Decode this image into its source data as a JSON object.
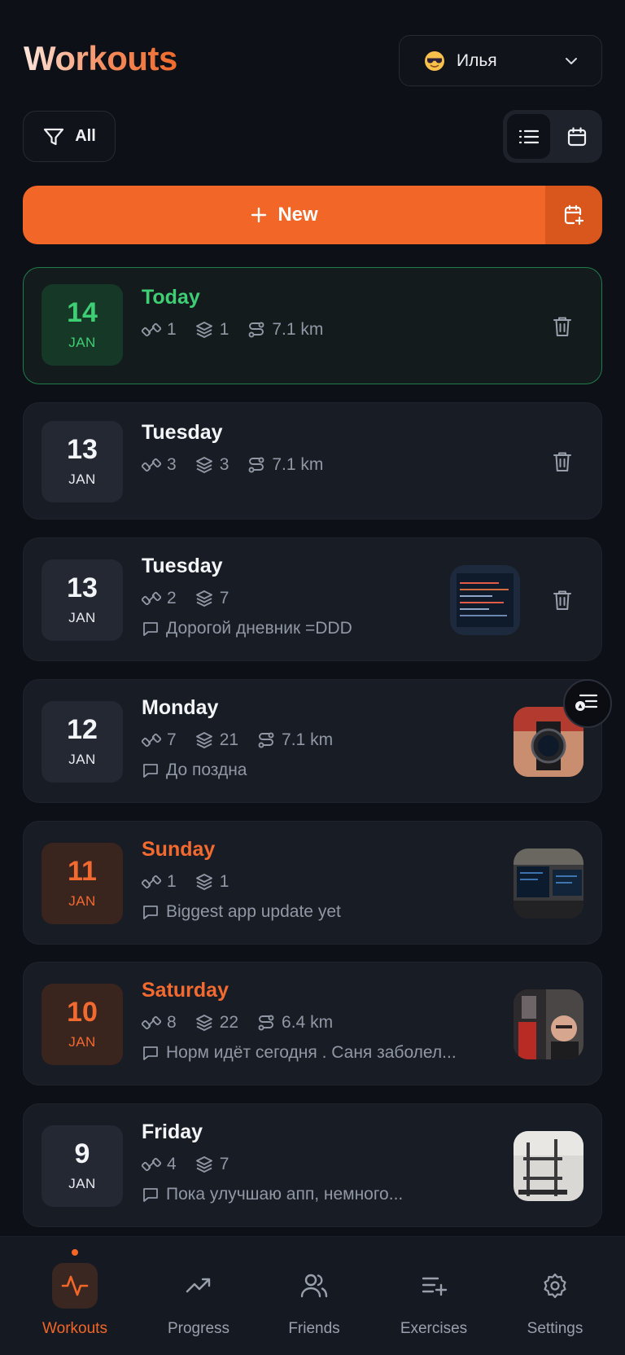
{
  "header": {
    "title": "Workouts",
    "user": {
      "name": "Илья",
      "avatar_icon": "smiling-face-with-sunglasses-emoji"
    }
  },
  "filter": {
    "label": "All"
  },
  "view_toggle": {
    "options": [
      "list",
      "calendar"
    ],
    "selected": "list"
  },
  "new_button": {
    "label": "New",
    "side_icon": "calendar-plus-icon"
  },
  "colors": {
    "accent": "#f26627",
    "today": "#3fce74",
    "weekend": "#f26a30",
    "background": "#0d1017",
    "card": "#181c25"
  },
  "workouts": [
    {
      "day": "14",
      "month": "JAN",
      "weekday": "Today",
      "exercises": "1",
      "sets": "1",
      "distance": "7.1 km",
      "note": "",
      "has_photo": false,
      "has_delete": true,
      "style": "today"
    },
    {
      "day": "13",
      "month": "JAN",
      "weekday": "Tuesday",
      "exercises": "3",
      "sets": "3",
      "distance": "7.1 km",
      "note": "",
      "has_photo": false,
      "has_delete": true,
      "style": "normal"
    },
    {
      "day": "13",
      "month": "JAN",
      "weekday": "Tuesday",
      "exercises": "2",
      "sets": "7",
      "distance": "",
      "note": "Дорогой дневник =DDD",
      "has_photo": true,
      "has_delete": true,
      "style": "normal"
    },
    {
      "day": "12",
      "month": "JAN",
      "weekday": "Monday",
      "exercises": "7",
      "sets": "21",
      "distance": "7.1 km",
      "note": "До поздна",
      "has_photo": true,
      "has_delete": false,
      "style": "normal"
    },
    {
      "day": "11",
      "month": "JAN",
      "weekday": "Sunday",
      "exercises": "1",
      "sets": "1",
      "distance": "",
      "note": "Biggest app update yet",
      "has_photo": true,
      "has_delete": false,
      "style": "weekend"
    },
    {
      "day": "10",
      "month": "JAN",
      "weekday": "Saturday",
      "exercises": "8",
      "sets": "22",
      "distance": "6.4 km",
      "note": "Норм идёт сегодня . Саня заболел...",
      "has_photo": true,
      "has_delete": false,
      "style": "weekend"
    },
    {
      "day": "9",
      "month": "JAN",
      "weekday": "Friday",
      "exercises": "4",
      "sets": "7",
      "distance": "",
      "note": "Пока улучшаю апп, немного...",
      "has_photo": true,
      "has_delete": false,
      "style": "normal"
    }
  ],
  "bottom_nav": {
    "items": [
      {
        "label": "Workouts",
        "icon": "activity-pulse-icon",
        "active": true
      },
      {
        "label": "Progress",
        "icon": "trending-up-icon",
        "active": false
      },
      {
        "label": "Friends",
        "icon": "users-icon",
        "active": false
      },
      {
        "label": "Exercises",
        "icon": "list-plus-icon",
        "active": false
      },
      {
        "label": "Settings",
        "icon": "gear-icon",
        "active": false
      }
    ]
  }
}
